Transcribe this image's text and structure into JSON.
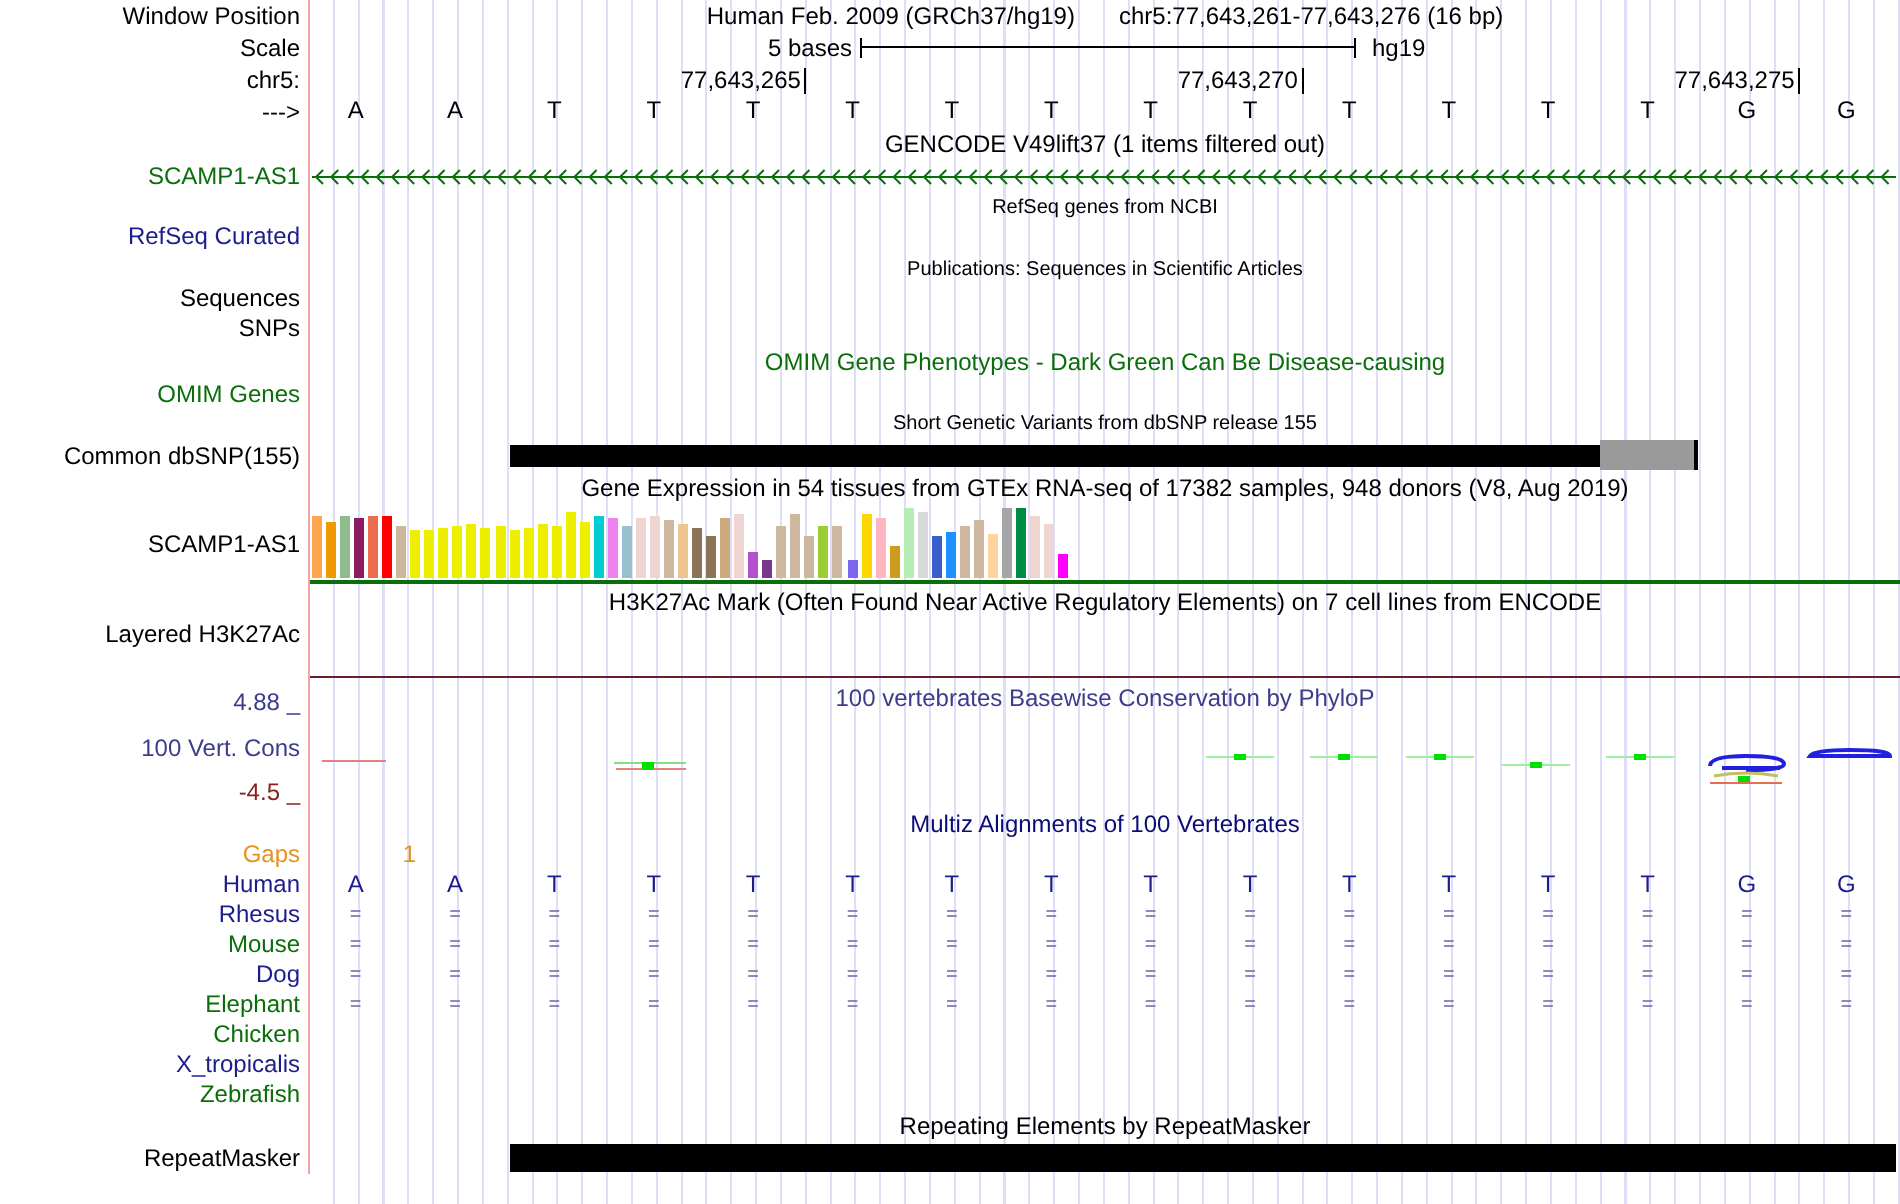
{
  "header": {
    "label": "Window Position",
    "assembly": "Human Feb. 2009 (GRCh37/hg19)",
    "position": "chr5:77,643,261-77,643,276 (16 bp)"
  },
  "scale": {
    "label": "Scale",
    "span": "5 bases",
    "genome": "hg19"
  },
  "ruler": {
    "label": "chr5:",
    "strand_label": "--->"
  },
  "bases": [
    {
      "letter": "A"
    },
    {
      "letter": "A"
    },
    {
      "letter": "T"
    },
    {
      "letter": "T"
    },
    {
      "letter": "T",
      "tick": "77,643,265"
    },
    {
      "letter": "T"
    },
    {
      "letter": "T"
    },
    {
      "letter": "T"
    },
    {
      "letter": "T"
    },
    {
      "letter": "T",
      "tick": "77,643,270"
    },
    {
      "letter": "T"
    },
    {
      "letter": "T"
    },
    {
      "letter": "T"
    },
    {
      "letter": "T"
    },
    {
      "letter": "G",
      "tick": "77,643,275"
    },
    {
      "letter": "G"
    }
  ],
  "tracks": [
    {
      "kind": "gene",
      "title": "GENCODE V49lift37 (1 items filtered out)",
      "labels": [
        {
          "text": "SCAMP1-AS1",
          "color": "#0a6e0a"
        }
      ]
    },
    {
      "kind": "sparse",
      "title": "RefSeq genes from NCBI",
      "labels": [
        {
          "text": "RefSeq Curated",
          "color": "#1c1c8c"
        }
      ]
    },
    {
      "kind": "sparse",
      "title": "Publications: Sequences in Scientific Articles",
      "labels": [
        {
          "text": "Sequences",
          "color": "#000000"
        },
        {
          "text": "SNPs",
          "color": "#000000"
        }
      ]
    },
    {
      "kind": "omim",
      "title": "OMIM Gene Phenotypes - Dark Green Can Be Disease-causing",
      "labels": [
        {
          "text": "OMIM Genes",
          "color": "#0a6e0a"
        }
      ]
    },
    {
      "kind": "snp",
      "title": "Short Genetic Variants from dbSNP release 155",
      "labels": [
        {
          "text": "Common dbSNP(155)",
          "color": "#000000"
        }
      ]
    },
    {
      "kind": "expression",
      "title": "Gene Expression in 54 tissues from GTEx RNA-seq of 17382 samples, 948 donors (V8, Aug 2019)",
      "labels": [
        {
          "text": "SCAMP1-AS1",
          "color": "#000000"
        }
      ],
      "bars": [
        {
          "color": "#ffa54f"
        },
        {
          "color": "#ee9a00"
        },
        {
          "color": "#8fbc8f"
        },
        {
          "color": "#8b1c62"
        },
        {
          "color": "#ee6a50"
        },
        {
          "color": "#ff0000"
        },
        {
          "color": "#cdb79e"
        },
        {
          "color": "#eeee00"
        },
        {
          "color": "#eeee00"
        },
        {
          "color": "#eeee00"
        },
        {
          "color": "#eeee00"
        },
        {
          "color": "#eeee00"
        },
        {
          "color": "#eeee00"
        },
        {
          "color": "#eeee00"
        },
        {
          "color": "#eeee00"
        },
        {
          "color": "#eeee00"
        },
        {
          "color": "#eeee00"
        },
        {
          "color": "#eeee00"
        },
        {
          "color": "#eeee00"
        },
        {
          "color": "#eeee00"
        },
        {
          "color": "#00cdcd"
        },
        {
          "color": "#ee82ee"
        },
        {
          "color": "#9ac0cd"
        },
        {
          "color": "#eed5d2"
        },
        {
          "color": "#eed5d2"
        },
        {
          "color": "#cdb79e"
        },
        {
          "color": "#eec591"
        },
        {
          "color": "#8b7355"
        },
        {
          "color": "#8b7355"
        },
        {
          "color": "#cdaa7d"
        },
        {
          "color": "#eed5d2"
        },
        {
          "color": "#b452cd"
        },
        {
          "color": "#7a378b"
        },
        {
          "color": "#cdb79e"
        },
        {
          "color": "#cdb79e"
        },
        {
          "color": "#cdb79e"
        },
        {
          "color": "#9acd32"
        },
        {
          "color": "#cdb79e"
        },
        {
          "color": "#7a67ee"
        },
        {
          "color": "#ffd700"
        },
        {
          "color": "#ffb6c1"
        },
        {
          "color": "#cd9b1d"
        },
        {
          "color": "#b4eeb4"
        },
        {
          "color": "#d9d9d9"
        },
        {
          "color": "#3a5fcd"
        },
        {
          "color": "#1e90ff"
        },
        {
          "color": "#cdb79e"
        },
        {
          "color": "#cdb79e"
        },
        {
          "color": "#ffd39b"
        },
        {
          "color": "#a6a6a6"
        },
        {
          "color": "#008b45"
        },
        {
          "color": "#eed5d2"
        },
        {
          "color": "#eed5d2"
        },
        {
          "color": "#ff00ff"
        }
      ]
    },
    {
      "kind": "signal",
      "title": "H3K27Ac Mark (Often Found Near Active Regulatory Elements) on 7 cell lines from ENCODE",
      "labels": [
        {
          "text": "Layered H3K27Ac",
          "color": "#000000"
        }
      ]
    },
    {
      "kind": "conservation",
      "title": "100 vertebrates Basewise Conservation by PhyloP",
      "labels": [
        {
          "text": "4.88 _",
          "color": "#3c3c8c"
        },
        {
          "text": "100 Vert. Cons",
          "color": "#3c3c8c"
        },
        {
          "text": "-4.5 _",
          "color": "#8b2020"
        }
      ]
    },
    {
      "kind": "multiz",
      "title": "Multiz Alignments of 100 Vertebrates",
      "gaps": {
        "label": "Gaps",
        "color": "#e8901c",
        "mark": "1"
      },
      "species": [
        {
          "name": "Human",
          "color": "#1c1c8c",
          "bases": [
            "A",
            "A",
            "T",
            "T",
            "T",
            "T",
            "T",
            "T",
            "T",
            "T",
            "T",
            "T",
            "T",
            "T",
            "G",
            "G"
          ]
        },
        {
          "name": "Rhesus",
          "color": "#1c1c8c",
          "bases": [
            "=",
            "=",
            "=",
            "=",
            "=",
            "=",
            "=",
            "=",
            "=",
            "=",
            "=",
            "=",
            "=",
            "=",
            "=",
            "="
          ]
        },
        {
          "name": "Mouse",
          "color": "#0a6e0a",
          "bases": [
            "=",
            "=",
            "=",
            "=",
            "=",
            "=",
            "=",
            "=",
            "=",
            "=",
            "=",
            "=",
            "=",
            "=",
            "=",
            "="
          ]
        },
        {
          "name": "Dog",
          "color": "#1c1c8c",
          "bases": [
            "=",
            "=",
            "=",
            "=",
            "=",
            "=",
            "=",
            "=",
            "=",
            "=",
            "=",
            "=",
            "=",
            "=",
            "=",
            "="
          ]
        },
        {
          "name": "Elephant",
          "color": "#0a6e0a",
          "bases": [
            "=",
            "=",
            "=",
            "=",
            "=",
            "=",
            "=",
            "=",
            "=",
            "=",
            "=",
            "=",
            "=",
            "=",
            "=",
            "="
          ]
        },
        {
          "name": "Chicken",
          "color": "#0a6e0a"
        },
        {
          "name": "X_tropicalis",
          "color": "#1c1c8c"
        },
        {
          "name": "Zebrafish",
          "color": "#0a6e0a"
        }
      ]
    },
    {
      "kind": "repeat",
      "title": "Repeating Elements by RepeatMasker",
      "labels": [
        {
          "text": "RepeatMasker",
          "color": "#000000"
        }
      ]
    }
  ]
}
